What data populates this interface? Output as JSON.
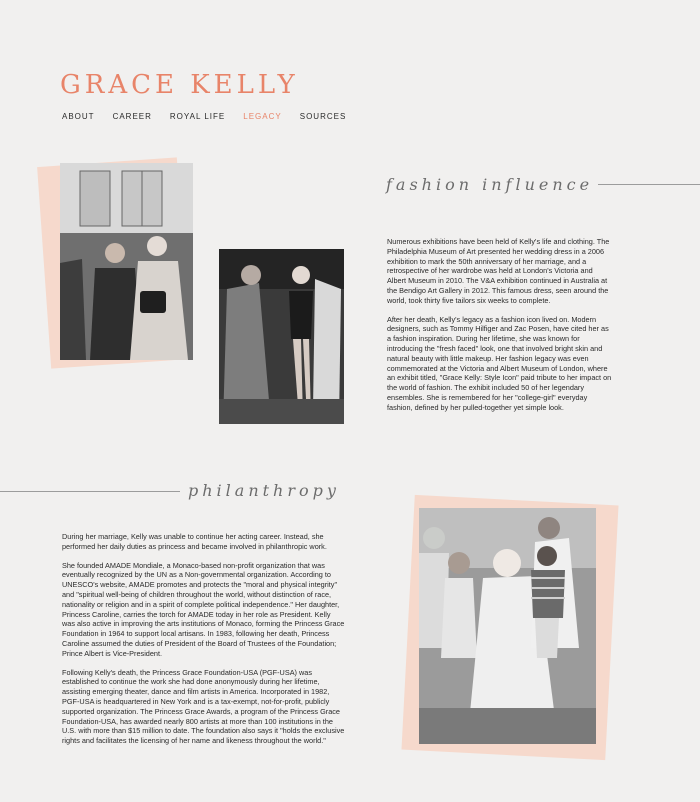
{
  "site": {
    "title": "GRACE KELLY"
  },
  "nav": [
    {
      "label": "ABOUT",
      "active": false
    },
    {
      "label": "CAREER",
      "active": false
    },
    {
      "label": "ROYAL LIFE",
      "active": false
    },
    {
      "label": "LEGACY",
      "active": true
    },
    {
      "label": "SOURCES",
      "active": false
    }
  ],
  "fashion": {
    "heading": "fashion influence",
    "paragraphs": [
      "Numerous exhibitions have been held of Kelly's life and clothing. The Philadelphia Museum of Art presented her wedding dress in a 2006 exhibition to mark the 50th anniversary of her marriage, and a retrospective of her wardrobe was held at London's Victoria and Albert Museum in 2010. The V&A exhibition continued in Australia at the Bendigo Art Gallery in 2012. This famous dress, seen around the world, took thirty five tailors six weeks to complete.",
      "After her death, Kelly's legacy as a fashion icon lived on. Modern designers, such as Tommy Hilfiger and Zac Posen, have cited her as a fashion inspiration. During her lifetime, she was known for introducing the \"fresh faced\" look, one that involved bright skin and natural beauty with little makeup. Her fashion legacy was even commemorated at the Victoria and Albert Museum of London, where an exhibit titled, \"Grace Kelly: Style Icon\" paid tribute to her impact on the world of fashion. The exhibit included 50 of her legendary ensembles. She is remembered for her \"college-girl\" everyday fashion, defined by her pulled-together yet simple look."
    ]
  },
  "philanthropy": {
    "heading": "philanthropy",
    "paragraphs": [
      "During her marriage, Kelly was unable to continue her acting career. Instead, she performed her daily duties as princess and became involved in philanthropic work.",
      "She founded AMADE Mondiale, a Monaco-based non-profit organization that was eventually recognized by the UN as a Non-governmental organization. According to UNESCO's website, AMADE promotes and protects the \"moral and physical integrity\" and \"spiritual well-being of children throughout the world, without distinction of race, nationality or religion and in a spirit of complete political independence.\" Her daughter, Princess Caroline, carries the torch for AMADE today in her role as President. Kelly was also active in improving the arts institutions of Monaco, forming the Princess Grace Foundation in 1964 to support local artisans. In 1983, following her death, Princess Caroline assumed the duties of President of the Board of Trustees of the Foundation; Prince Albert is Vice-President.",
      "Following Kelly's death, the Princess Grace Foundation-USA (PGF-USA) was established to continue the work she had done anonymously during her lifetime, assisting emerging theater, dance and film artists in America. Incorporated in 1982, PGF-USA is headquartered in New York and is a tax-exempt, not-for-profit, publicly supported organization. The Princess Grace Awards, a program of the Princess Grace Foundation-USA, has awarded nearly 800 artists at more than 100 institutions in the U.S. with more than $15 million to date. The foundation also says it \"holds the exclusive rights and facilitates the licensing of her name and likeness throughout the world.\""
    ]
  }
}
